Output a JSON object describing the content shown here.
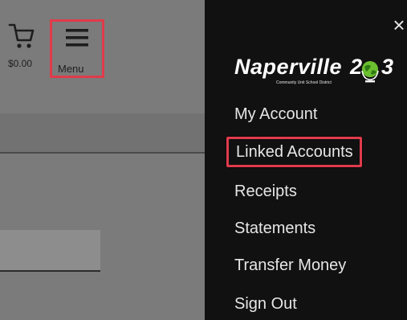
{
  "header": {
    "cart_amount": "$0.00",
    "menu_label": "Menu"
  },
  "drawer": {
    "close_symbol": "×",
    "logo": {
      "name": "Naperville",
      "number": "2",
      "number_end": "3",
      "subtitle": "Community Unit School District"
    },
    "items": [
      {
        "label": "My Account"
      },
      {
        "label": "Linked Accounts"
      },
      {
        "label": "Receipts"
      },
      {
        "label": "Statements"
      },
      {
        "label": "Transfer Money"
      },
      {
        "label": "Sign Out"
      }
    ]
  },
  "colors": {
    "drawer_bg": "#111111",
    "highlight": "#e03b4b",
    "backdrop": "#7b7b7b"
  },
  "icons": [
    "cart-icon",
    "hamburger-icon",
    "close-icon",
    "globe-icon"
  ]
}
